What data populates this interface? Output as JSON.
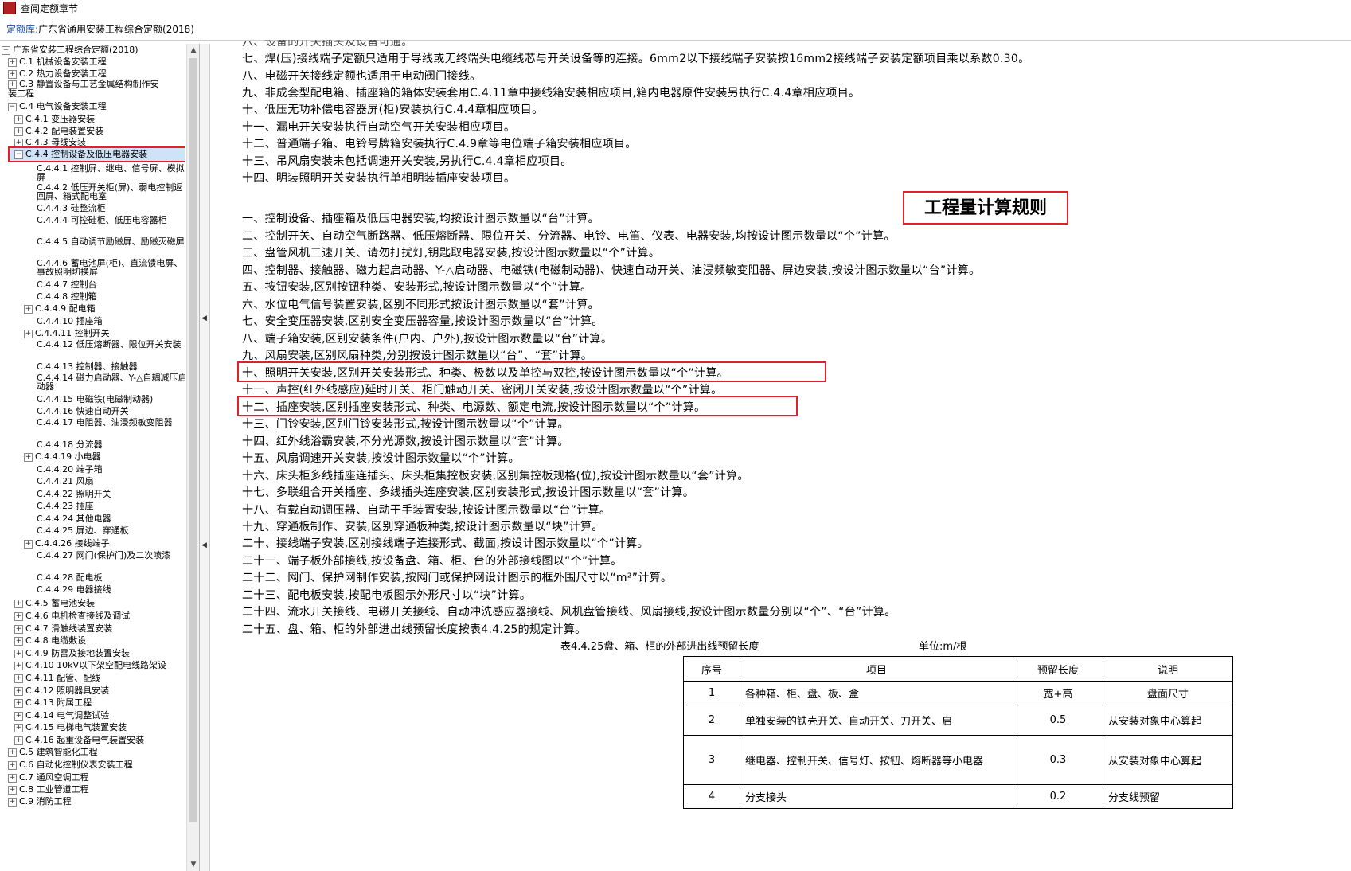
{
  "window": {
    "title": "查阅定额章节"
  },
  "db": {
    "label": "定额库:",
    "value": "广东省通用安装工程综合定额(2018)"
  },
  "tree": {
    "root": "广东省安装工程综合定额(2018)",
    "n1": "C.1 机械设备安装工程",
    "n2": "C.2 热力设备安装工程",
    "n3": "C.3 静置设备与工艺金属结构制作安装工程",
    "n4": "C.4 电气设备安装工程",
    "n41": "C.4.1 变压器安装",
    "n42": "C.4.2 配电装置安装",
    "n43": "C.4.3 母线安装",
    "n44": "C.4.4 控制设备及低压电器安装",
    "l1": "C.4.4.1 控制屏、继电、信号屏、模拟屏",
    "l2": "C.4.4.2 低压开关柜(屏)、弱电控制返回屏、箱式配电室",
    "l3": "C.4.4.3 硅整流柜",
    "l4": "C.4.4.4 可控硅柜、低压电容器柜",
    "l5": "C.4.4.5 自动调节励磁屏、励磁灭磁屏",
    "l6": "C.4.4.6 蓄电池屏(柜)、直流馈电屏、事故照明切换屏",
    "l7": "C.4.4.7 控制台",
    "l8": "C.4.4.8 控制箱",
    "l9": "C.4.4.9 配电箱",
    "l10": "C.4.4.10 插座箱",
    "l11": "C.4.4.11 控制开关",
    "l12": "C.4.4.12 低压熔断器、限位开关安装",
    "l13": "C.4.4.13 控制器、接触器",
    "l14": "C.4.4.14 磁力启动器、Y-△自耦减压启动器",
    "l15": "C.4.4.15 电磁铁(电磁制动器)",
    "l16": "C.4.4.16 快速自动开关",
    "l17": "C.4.4.17 电阻器、油浸频敏变阻器",
    "l18": "C.4.4.18 分流器",
    "l19": "C.4.4.19 小电器",
    "l20": "C.4.4.20 端子箱",
    "l21": "C.4.4.21 风扇",
    "l22": "C.4.4.22 照明开关",
    "l23": "C.4.4.23 插座",
    "l24": "C.4.4.24 其他电器",
    "l25": "C.4.4.25 屏边、穿通板",
    "l26": "C.4.4.26 接线端子",
    "l27": "C.4.4.27 网门(保护门)及二次喷漆",
    "l28": "C.4.4.28 配电板",
    "l29": "C.4.4.29 电器接线",
    "n45": "C.4.5 蓄电池安装",
    "n46": "C.4.6 电机检查接线及调试",
    "n47": "C.4.7 滑触线装置安装",
    "n48": "C.4.8 电缆敷设",
    "n49": "C.4.9 防雷及接地装置安装",
    "n410": "C.4.10 10kV以下架空配电线路架设",
    "n411": "C.4.11 配管、配线",
    "n412": "C.4.12 照明器具安装",
    "n413": "C.4.13 附属工程",
    "n414": "C.4.14 电气调整试验",
    "n415": "C.4.15 电梯电气装置安装",
    "n416": "C.4.16 起重设备电气装置安装",
    "n5": "C.5 建筑智能化工程",
    "n6": "C.6 自动化控制仪表安装工程",
    "n7": "C.7 通风空调工程",
    "n8": "C.8 工业管道工程",
    "n9": "C.9 消防工程"
  },
  "notes": {
    "t0": "六、设备的开关插头及设备可通。",
    "t7": "七、焊(压)接线端子定额只适用于导线或无终端头电缆线芯与开关设备等的连接。6mm2以下接线端子安装按16mm2接线端子安装定额项目乘以系数0.30。",
    "t8": "八、电磁开关接线定额也适用于电动阀门接线。",
    "t9": "九、非成套型配电箱、插座箱的箱体安装套用C.4.11章中接线箱安装相应项目,箱内电器原件安装另执行C.4.4章相应项目。",
    "t10": "十、低压无功补偿电容器屏(柜)安装执行C.4.4章相应项目。",
    "t11": "十一、漏电开关安装执行自动空气开关安装相应项目。",
    "t12": "十二、普通端子箱、电铃号牌箱安装执行C.4.9章等电位端子箱安装相应项目。",
    "t13": "十三、吊风扇安装未包括调速开关安装,另执行C.4.4章相应项目。",
    "t14": "十四、明装照明开关安装执行单相明装插座安装项目。"
  },
  "rules_title": "工程量计算规则",
  "rules": {
    "r1": "一、控制设备、插座箱及低压电器安装,均按设计图示数量以“台”计算。",
    "r2": "二、控制开关、自动空气断路器、低压熔断器、限位开关、分流器、电铃、电笛、仪表、电器安装,均按设计图示数量以“个”计算。",
    "r3": "三、盘管风机三速开关、请勿打扰灯,钥匙取电器安装,按设计图示数量以“个”计算。",
    "r4": "四、控制器、接触器、磁力起启动器、Y-△启动器、电磁铁(电磁制动器)、快速自动开关、油浸频敏变阻器、屏边安装,按设计图示数量以“台”计算。",
    "r5": "五、按钮安装,区别按钮种类、安装形式,按设计图示数量以“个”计算。",
    "r6": "六、水位电气信号装置安装,区别不同形式按设计图示数量以“套”计算。",
    "r7": "七、安全变压器安装,区别安全变压器容量,按设计图示数量以“台”计算。",
    "r8": "八、端子箱安装,区别安装条件(户内、户外),按设计图示数量以“台”计算。",
    "r9": "九、风扇安装,区别风扇种类,分别按设计图示数量以“台”、“套”计算。",
    "r10": "十、照明开关安装,区别开关安装形式、种类、极数以及单控与双控,按设计图示数量以“个”计算。",
    "r11": "十一、声控(红外线感应)延时开关、柜门触动开关、密闭开关安装,按设计图示数量以“个”计算。",
    "r12": "十二、插座安装,区别插座安装形式、种类、电源数、额定电流,按设计图示数量以“个”计算。",
    "r13": "十三、门铃安装,区别门铃安装形式,按设计图示数量以“个”计算。",
    "r14": "十四、红外线浴霸安装,不分光源数,按设计图示数量以“套”计算。",
    "r15": "十五、风扇调速开关安装,按设计图示数量以“个”计算。",
    "r16": "十六、床头柜多线插座连插头、床头柜集控板安装,区别集控板规格(位),按设计图示数量以“套”计算。",
    "r17": "十七、多联组合开关插座、多线插头连座安装,区别安装形式,按设计图示数量以“套”计算。",
    "r18": "十八、有载自动调压器、自动干手装置安装,按设计图示数量以“台”计算。",
    "r19": "十九、穿通板制作、安装,区别穿通板种类,按设计图示数量以“块”计算。",
    "r20": "二十、接线端子安装,区别接线端子连接形式、截面,按设计图示数量以“个”计算。",
    "r21": "二十一、端子板外部接线,按设备盘、箱、柜、台的外部接线图以“个”计算。",
    "r22": "二十二、网门、保护网制作安装,按网门或保护网设计图示的框外围尺寸以“m²”计算。",
    "r23": "二十三、配电板安装,按配电板图示外形尺寸以“块”计算。",
    "r24": "二十四、流水开关接线、电磁开关接线、自动冲洗感应器接线、风机盘管接线、风扇接线,按设计图示数量分别以“个”、“台”计算。",
    "r25": "二十五、盘、箱、柜的外部进出线预留长度按表4.4.25的规定计算。"
  },
  "table": {
    "caption": "表4.4.25盘、箱、柜的外部进出线预留长度",
    "unit": "单位:m/根",
    "headers": [
      "序号",
      "项目",
      "预留长度",
      "说明"
    ],
    "rows": [
      [
        "1",
        "各种箱、柜、盘、板、盒",
        "宽+高",
        "盘面尺寸"
      ],
      [
        "2",
        "单独安装的铁壳开关、自动开关、刀开关、启",
        "0.5",
        "从安装对象中心算起"
      ],
      [
        "3",
        "继电器、控制开关、信号灯、按钮、熔断器等小电器",
        "0.3",
        "从安装对象中心算起"
      ],
      [
        "4",
        "分支接头",
        "0.2",
        "分支线预留"
      ]
    ]
  }
}
